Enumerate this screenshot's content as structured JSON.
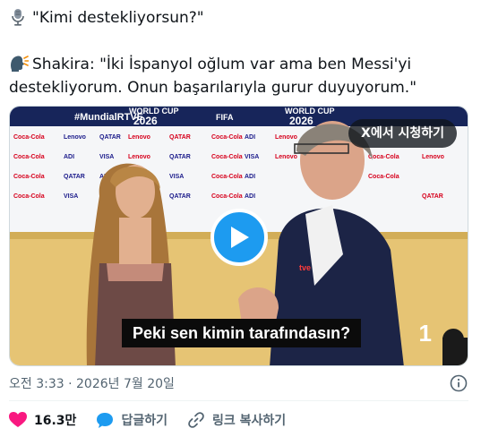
{
  "tweet": {
    "line1": "\"Kimi destekliyorsun?\"",
    "line2": "Shakira: \"İki İspanyol oğlum var ama ben Messi'yi",
    "line3": "destekliyorum. Onun başarılarıyla gurur duyuyorum.\"",
    "icons": {
      "line1": "microphone-icon",
      "line2": "speaking-head-icon"
    }
  },
  "video": {
    "watch_label": "X에서 시청하기",
    "subtitle": "Peki sen kimin tarafındasın?",
    "counter": "1",
    "backdrop_texts": [
      "#MundialRTVE",
      "WORLD CUP",
      "2026",
      "FIFA",
      "WORLD CUP",
      "2026"
    ]
  },
  "meta": {
    "timestamp": "오전 3:33 · 2026년 7월 20일"
  },
  "actions": {
    "like_count": "16.3만",
    "reply_label": "답글하기",
    "copy_link_label": "링크 복사하기"
  },
  "colors": {
    "accent": "#1d9bf0",
    "like": "#f91880",
    "muted": "#536471"
  }
}
